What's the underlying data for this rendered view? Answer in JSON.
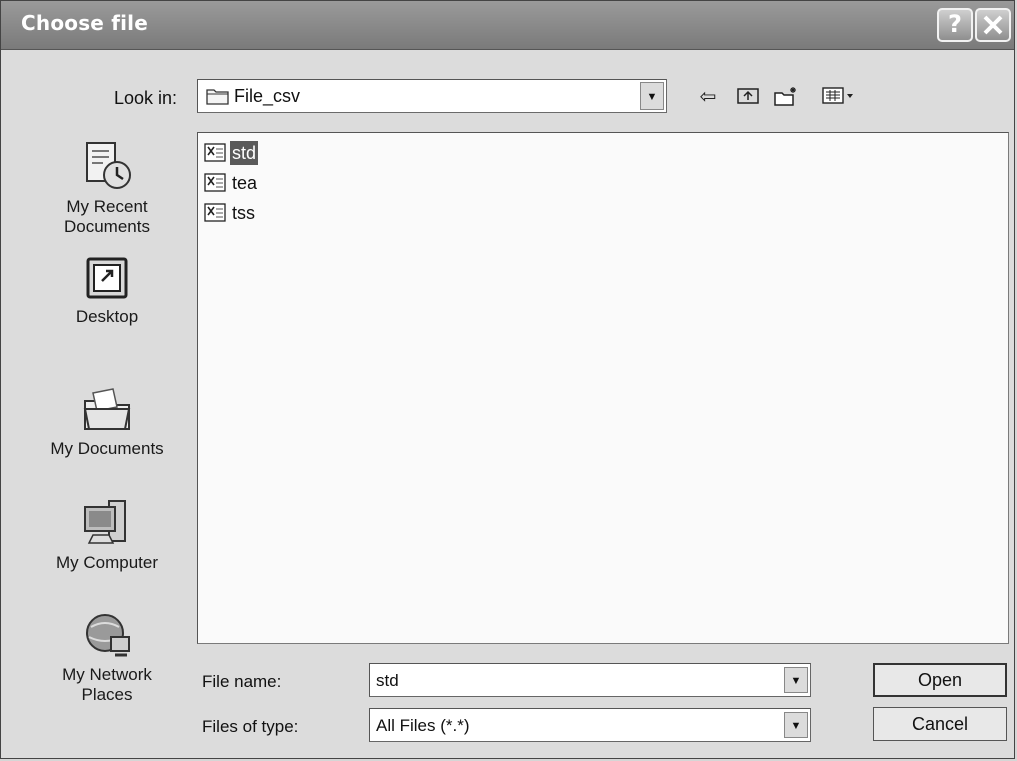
{
  "window": {
    "title": "Choose file"
  },
  "toolbar": {
    "lookin_label": "Look in:",
    "lookin_value": "File_csv",
    "icons": [
      "back-arrow-icon",
      "up-folder-icon",
      "new-folder-icon",
      "view-menu-icon"
    ]
  },
  "places": [
    {
      "label": "My Recent\nDocuments",
      "icon": "recent-documents-icon"
    },
    {
      "label": "Desktop",
      "icon": "desktop-icon"
    },
    {
      "label": "My Documents",
      "icon": "my-documents-icon"
    },
    {
      "label": "My Computer",
      "icon": "my-computer-icon"
    },
    {
      "label": "My Network\nPlaces",
      "icon": "network-places-icon"
    }
  ],
  "files": [
    {
      "name": "std",
      "selected": true
    },
    {
      "name": "tea",
      "selected": false
    },
    {
      "name": "tss",
      "selected": false
    }
  ],
  "filename": {
    "label": "File name:",
    "value": "std"
  },
  "filetype": {
    "label": "Files of type:",
    "value": "All Files (*.*)"
  },
  "buttons": {
    "open": "Open",
    "cancel": "Cancel"
  },
  "colors": {
    "titlebar": "#8a8a8a",
    "selection": "#5a5a5a"
  }
}
